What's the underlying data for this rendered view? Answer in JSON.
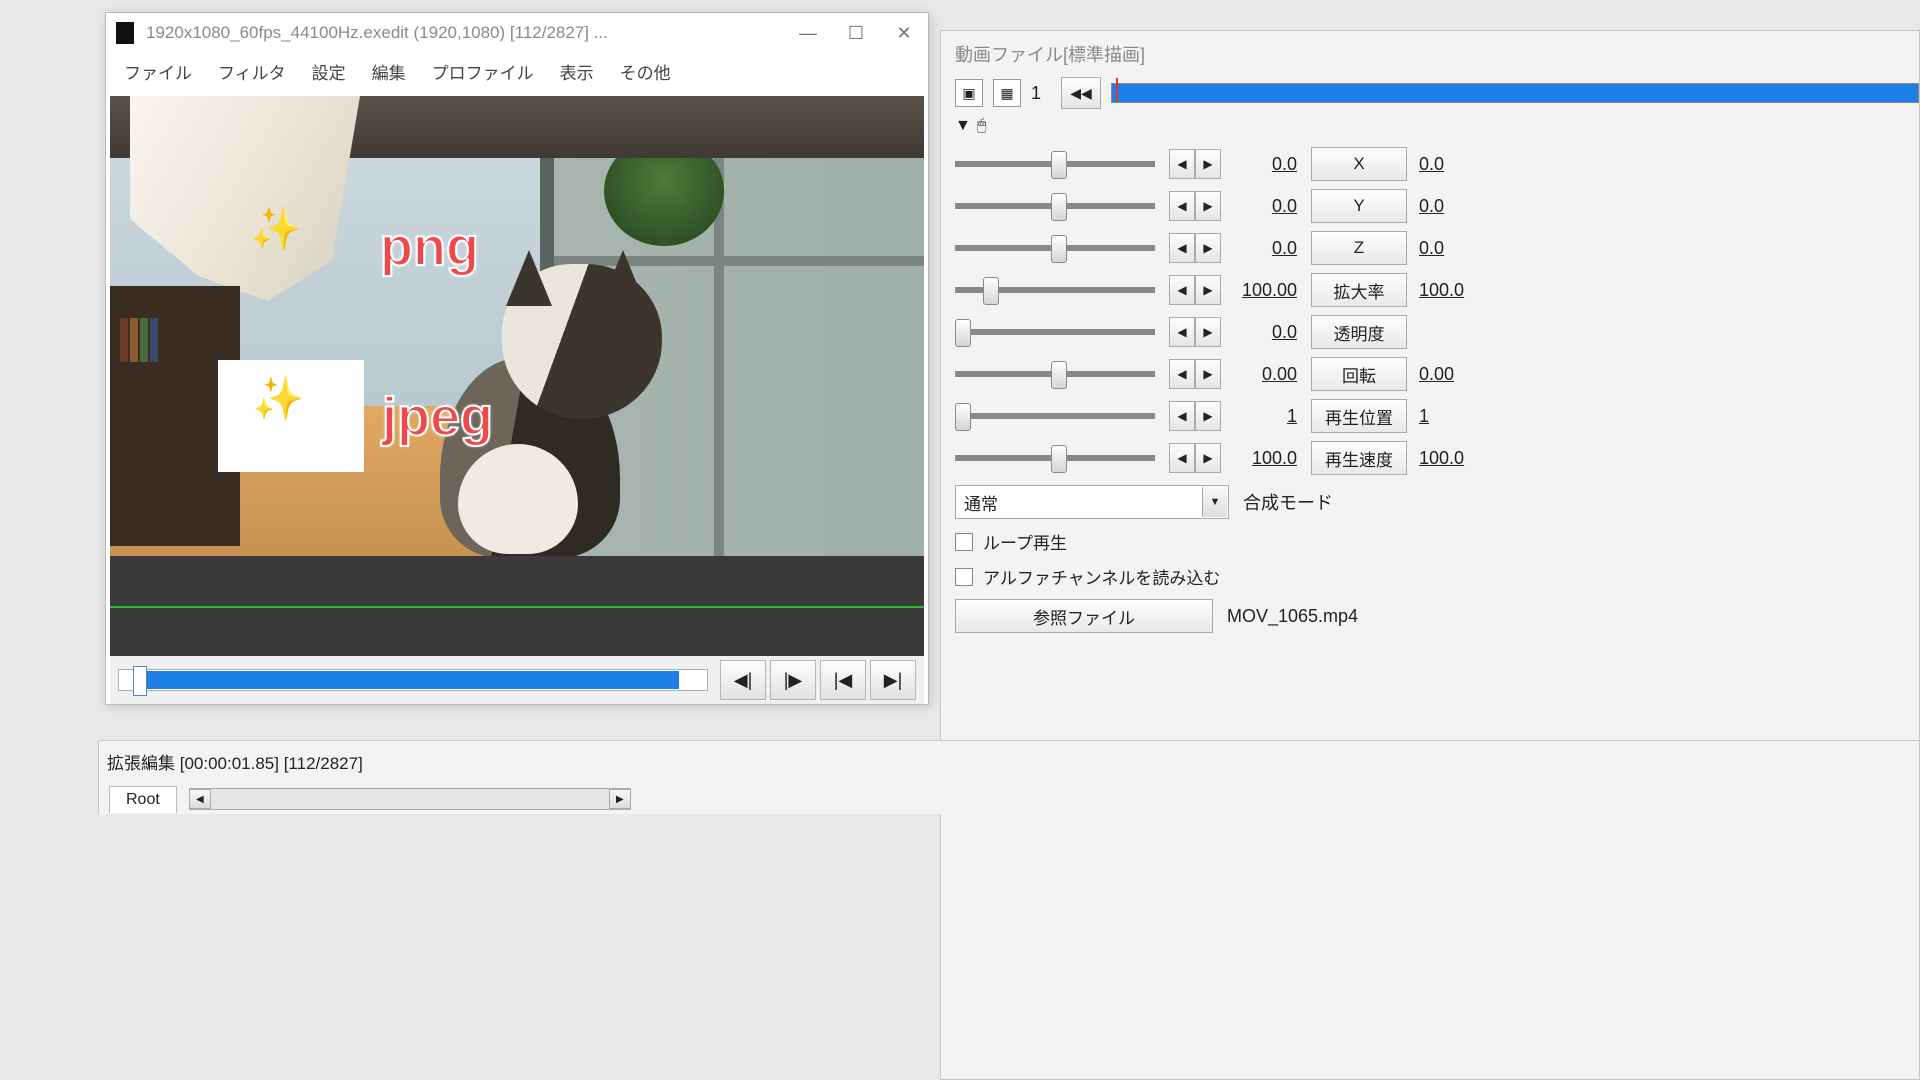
{
  "aviutl": {
    "title": "1920x1080_60fps_44100Hz.exedit (1920,1080)  [112/2827]  ...",
    "menus": [
      "ファイル",
      "フィルタ",
      "設定",
      "編集",
      "プロファイル",
      "表示",
      "その他"
    ],
    "overlay_png": "png",
    "overlay_jpeg": "jpeg"
  },
  "props": {
    "title": "動画ファイル[標準描画]",
    "frame_number": "1",
    "mouse_dropdown": "▼",
    "params": [
      {
        "value": "0.0",
        "label": "X",
        "value2": "0.0",
        "thumb": 48
      },
      {
        "value": "0.0",
        "label": "Y",
        "value2": "0.0",
        "thumb": 48
      },
      {
        "value": "0.0",
        "label": "Z",
        "value2": "0.0",
        "thumb": 48
      },
      {
        "value": "100.00",
        "label": "拡大率",
        "value2": "100.0",
        "thumb": 14
      },
      {
        "value": "0.0",
        "label": "透明度",
        "value2": "",
        "thumb": 0
      },
      {
        "value": "0.00",
        "label": "回転",
        "value2": "0.00",
        "thumb": 48
      },
      {
        "value": "1",
        "label": "再生位置",
        "value2": "1",
        "thumb": 0
      },
      {
        "value": "100.0",
        "label": "再生速度",
        "value2": "100.0",
        "thumb": 48
      }
    ],
    "blend_value": "通常",
    "blend_label": "合成モード",
    "loop": "ループ再生",
    "alpha": "アルファチャンネルを読み込む",
    "ref_btn": "参照ファイル",
    "ref_file": "MOV_1065.mp4"
  },
  "timeline": {
    "title": "拡張編集 [00:00:01.85] [112/2827]",
    "root": "Root"
  }
}
